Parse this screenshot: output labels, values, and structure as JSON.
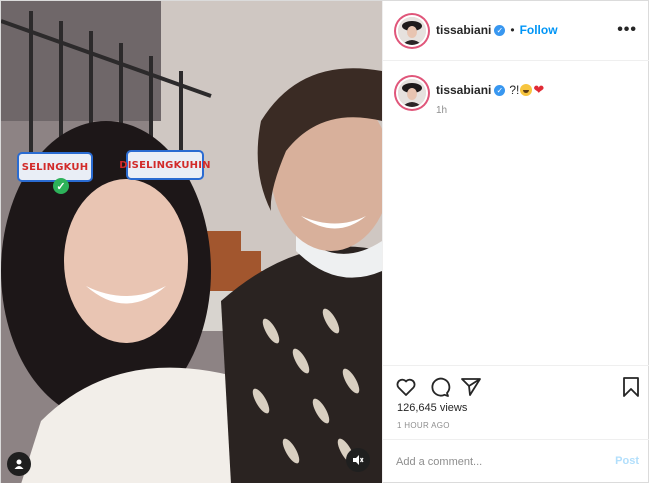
{
  "media": {
    "filter_left": "SELINGKUH",
    "filter_left_check": "✓",
    "filter_right": "DISELINGKUHIN",
    "user_tag_icon": "person-icon",
    "audio_icon": "muted-speaker-icon"
  },
  "header": {
    "username": "tissabiani",
    "verified_glyph": "✓",
    "separator": "•",
    "follow_label": "Follow",
    "more_label": "•••"
  },
  "caption": {
    "username": "tissabiani",
    "verified_glyph": "✓",
    "text": "?!",
    "emoji": "grinning-squint-emoji",
    "heart": "❤",
    "time": "1h"
  },
  "actions": {
    "like_icon": "heart-outline-icon",
    "comment_icon": "comment-bubble-icon",
    "share_icon": "paper-plane-icon",
    "save_icon": "bookmark-icon"
  },
  "stats": {
    "views": "126,645 views",
    "posted": "1 HOUR AGO"
  },
  "comment": {
    "placeholder": "Add a comment...",
    "post_label": "Post"
  },
  "colors": {
    "accent": "#0095f6",
    "verified": "#3897f0",
    "ring": "#e0567a",
    "heart": "#e02a35",
    "filter_text": "#d22a2a",
    "filter_border": "#2a6bd1"
  }
}
